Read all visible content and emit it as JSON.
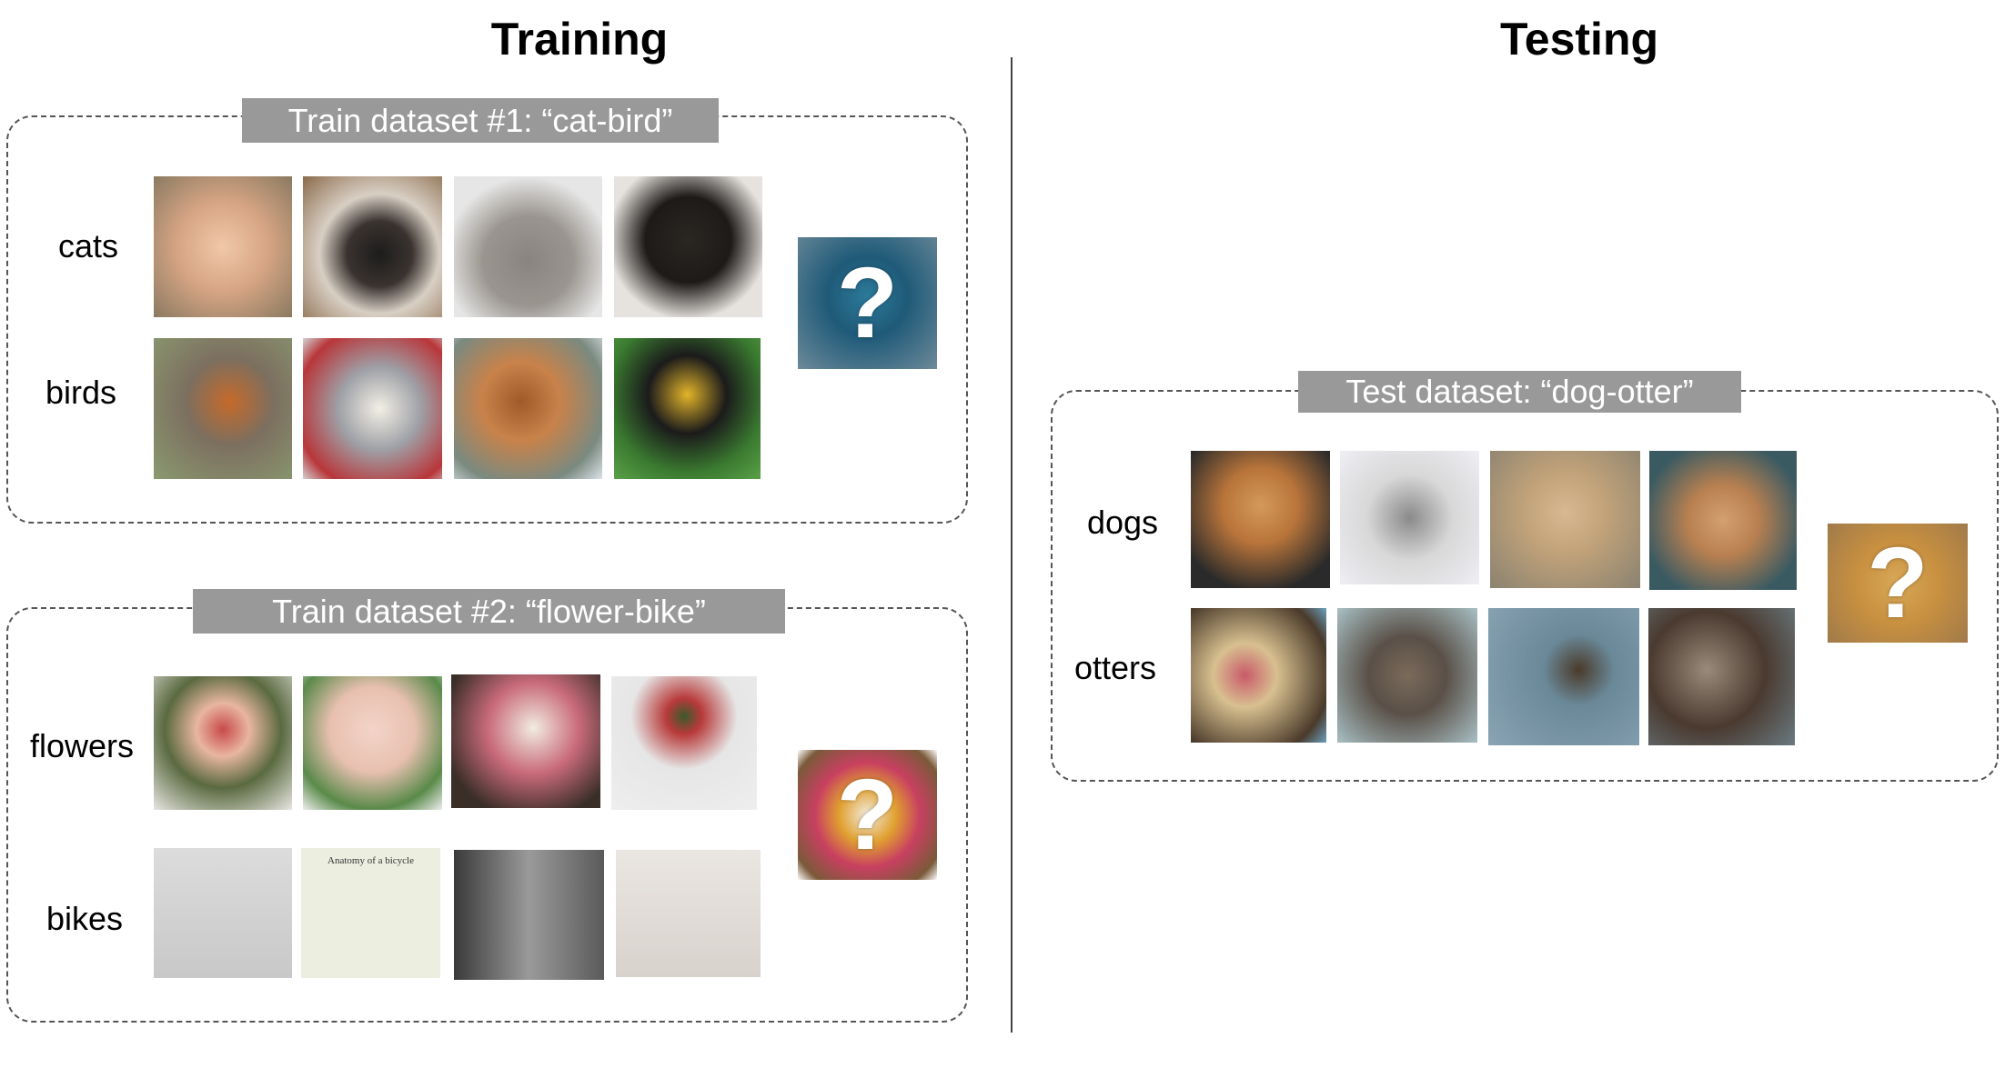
{
  "training": {
    "title": "Training",
    "dataset1": {
      "label": "Train dataset #1: “cat-bird”",
      "classes": [
        "cats",
        "birds"
      ],
      "query_mark": "?"
    },
    "dataset2": {
      "label": "Train dataset #2: “flower-bike”",
      "classes": [
        "flowers",
        "bikes"
      ],
      "query_mark": "?",
      "bike_diagram_caption": "Anatomy of a bicycle"
    }
  },
  "testing": {
    "title": "Testing",
    "dataset": {
      "label": "Test dataset: “dog-otter”",
      "classes": [
        "dogs",
        "otters"
      ],
      "query_mark": "?"
    }
  },
  "colors": {
    "label_background": "#999999",
    "label_text": "#ffffff",
    "dashed_border": "#555555"
  }
}
